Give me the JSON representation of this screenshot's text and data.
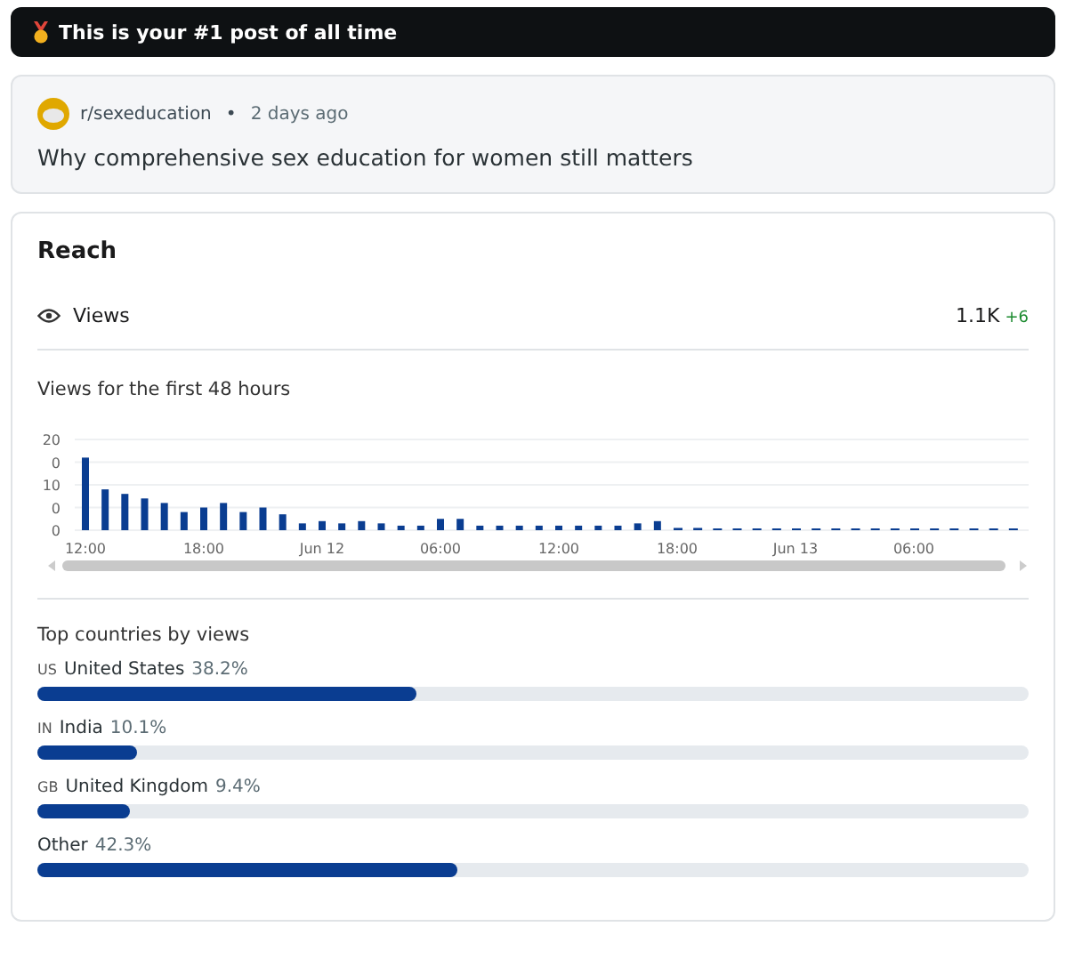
{
  "banner": {
    "text": "This is your #1 post of all time"
  },
  "post": {
    "community": "r/sexeducation",
    "separator": "•",
    "age": "2 days ago",
    "title": "Why comprehensive sex education for women still matters"
  },
  "reach": {
    "title": "Reach",
    "metric": {
      "label": "Views",
      "value": "1.1K",
      "delta": "+6"
    },
    "chart_caption": "Views for the first 48 hours",
    "chart": {
      "y_labels": [
        "20",
        "0",
        "10",
        "0",
        "0"
      ],
      "x_labels": [
        "12:00",
        "18:00",
        "Jun 12",
        "06:00",
        "12:00",
        "18:00",
        "Jun 13",
        "06:00"
      ]
    },
    "countries_title": "Top countries by views",
    "countries": [
      {
        "code": "US",
        "name": "United States",
        "share": "38.2%",
        "level": 0.382
      },
      {
        "code": "IN",
        "name": "India",
        "share": "10.1%",
        "level": 0.101
      },
      {
        "code": "GB",
        "name": "United Kingdom",
        "share": "9.4%",
        "level": 0.094
      },
      {
        "name": "Other",
        "share": "42.3%",
        "level": 0.423
      }
    ]
  }
}
